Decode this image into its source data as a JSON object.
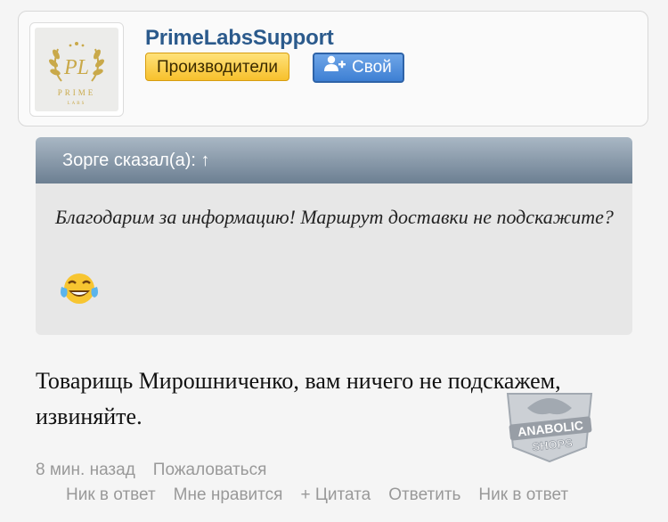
{
  "author": {
    "username": "PrimeLabsSupport",
    "badge_label": "Производители",
    "own_button_label": "Свой",
    "avatar_logo": {
      "monogram": "PL",
      "line1": "PRIME",
      "line2": "LABS"
    }
  },
  "quote": {
    "header": "Зорге сказал(а): ↑",
    "text": "Благодарим за информацию! Маршрут доставки не подскажите?",
    "emoji_icon": "tears-of-joy-emoji"
  },
  "reply": {
    "text": "Товарищь Мирошниченко, вам ничего не подскажем, извиняйте."
  },
  "watermark": {
    "line1": "ANABOLIC",
    "line2": "SHOPS"
  },
  "meta": {
    "time": "8 мин. назад",
    "report": "Пожаловаться"
  },
  "actions": [
    "Ник в ответ",
    "Мне нравится",
    "+ Цитата",
    "Ответить",
    "Ник в ответ"
  ],
  "colors": {
    "username": "#2b5a8c",
    "badge": "#f7c02c",
    "own_button": "#3d7fd3",
    "quote_header": "#6c7f92"
  }
}
